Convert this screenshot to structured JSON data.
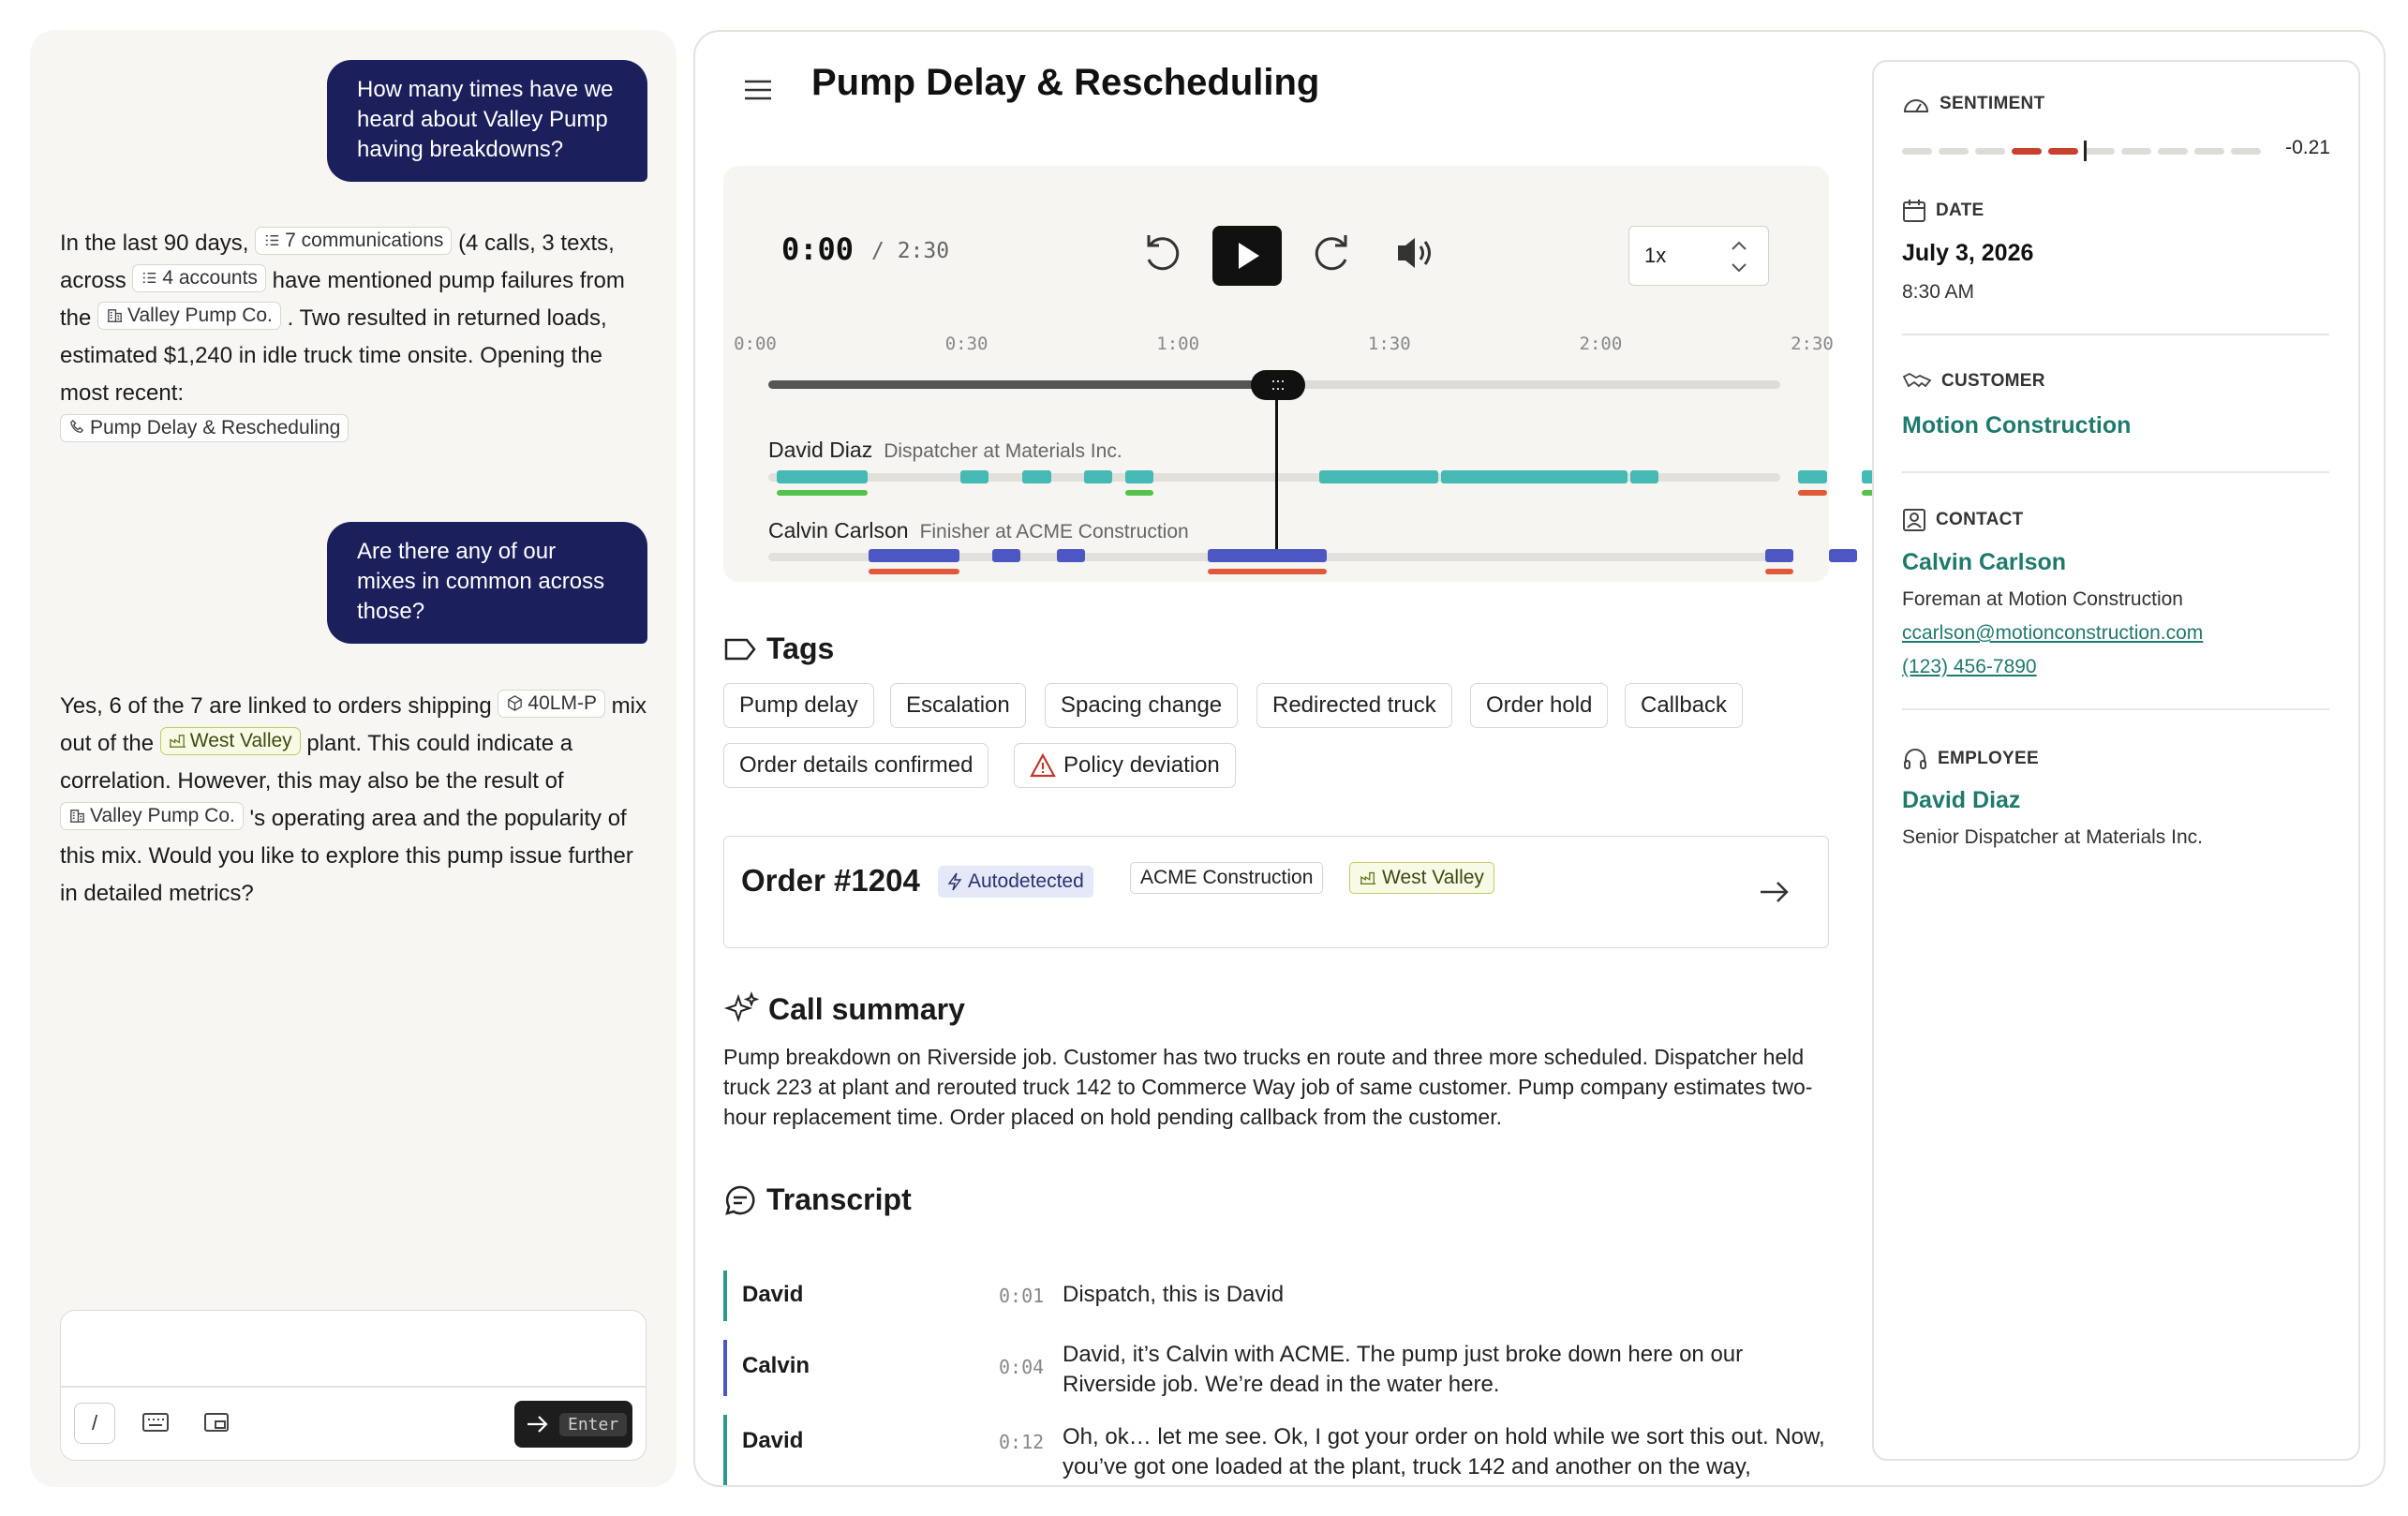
{
  "chat": {
    "messages": [
      {
        "role": "user",
        "text": "How many times have we heard about Valley Pump having breakdowns?"
      },
      {
        "role": "assistant",
        "p1": "In the last 90 days,",
        "chip_comms": "7 communications",
        "p2": "(4 calls, 3 texts, across",
        "chip_accounts": "4 accounts",
        "p3": "have mentioned pump failures from the",
        "chip_company": "Valley Pump Co.",
        "p4": ". Two resulted in returned loads, estimated $1,240 in idle truck time onsite. Opening the most recent:",
        "chip_call": "Pump Delay & Rescheduling"
      },
      {
        "role": "user",
        "text": "Are there any of our mixes in common across those?"
      },
      {
        "role": "assistant",
        "p1": "Yes, 6 of the 7 are linked to orders shipping",
        "chip_mix": "40LM-P",
        "p2": "mix out of the",
        "chip_plant": "West Valley",
        "p3": "plant. This could indicate a correlation. However, this may also be the result of",
        "chip_company": "Valley Pump Co.",
        "p4": "'s operating area and the popularity of this mix. Would you like to explore this pump issue further in detailed metrics?"
      }
    ],
    "composer": {
      "slash": "/",
      "enter_key": "Enter"
    }
  },
  "call": {
    "title": "Pump Delay & Rescheduling",
    "player": {
      "current": "0:00",
      "total": "/ 2:30",
      "speed": "1x",
      "ticks": [
        "0:00",
        "0:30",
        "1:00",
        "1:30",
        "2:00",
        "2:30"
      ],
      "handle_glyph": ":::",
      "progress_seconds": 75,
      "speakers": [
        {
          "name": "David Diaz",
          "role": "Dispatcher at Materials Inc."
        },
        {
          "name": "Calvin Carlson",
          "role": "Finisher at ACME Construction"
        }
      ]
    },
    "tags_heading": "Tags",
    "tags": [
      "Pump delay",
      "Escalation",
      "Spacing change",
      "Redirected truck",
      "Order hold",
      "Callback",
      "Order details confirmed",
      "Policy deviation"
    ],
    "order": {
      "number": "Order #1204",
      "autodetected": "Autodetected",
      "customer": "ACME Construction",
      "plant": "West Valley"
    },
    "summary_heading": "Call summary",
    "summary": "Pump breakdown on Riverside job. Customer has two trucks en route and three more scheduled. Dispatcher held truck 223 at plant and rerouted truck 142 to Commerce Way job of same customer. Pump company estimates two-hour replacement time. Order placed on hold pending callback from the customer.",
    "transcript_heading": "Transcript",
    "transcript": [
      {
        "speaker": "David",
        "time": "0:01",
        "text": "Dispatch, this is David"
      },
      {
        "speaker": "Calvin",
        "time": "0:04",
        "text": "David, it’s Calvin with ACME. The pump just broke down here on our Riverside job. We’re dead in the water here."
      },
      {
        "speaker": "David",
        "time": "0:12",
        "text": "Oh, ok… let me see. Ok, I got your order on hold while we sort this out. Now, you’ve got one loaded at the plant, truck 142 and another on the way,"
      }
    ]
  },
  "details": {
    "sentiment_label": "SENTIMENT",
    "sentiment_value": "-0.21",
    "date_label": "DATE",
    "date": "July 3, 2026",
    "time": "8:30 AM",
    "customer_label": "CUSTOMER",
    "customer": "Motion Construction",
    "contact_label": "CONTACT",
    "contact_name": "Calvin Carlson",
    "contact_title": "Foreman at Motion Construction",
    "contact_email": "ccarlson@motionconstruction.com",
    "contact_phone": "(123) 456-7890",
    "employee_label": "EMPLOYEE",
    "employee_name": "David Diaz",
    "employee_title": "Senior Dispatcher at Materials Inc."
  },
  "colors": {
    "user_bubble": "#1b1f5c",
    "david": "#45b9b3",
    "calvin": "#4c57c4",
    "green": "#55c24a",
    "red": "#e05a3a",
    "teal_text": "#1f7a6e",
    "sentiment_neg": "#c7422c"
  }
}
